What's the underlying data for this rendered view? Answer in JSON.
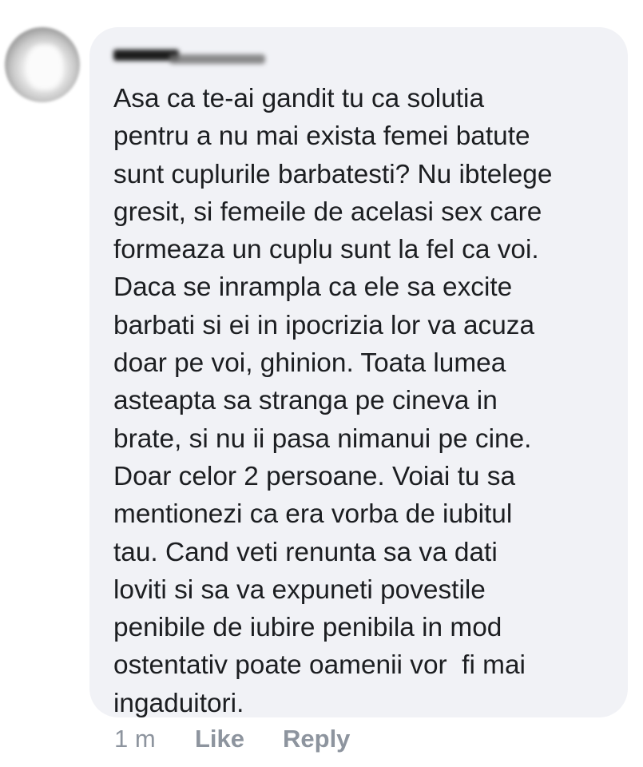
{
  "comment": {
    "author_redacted": true,
    "text_lines": [
      "Asa ca te-ai gandit tu ca solutia",
      "pentru a nu mai exista femei batute",
      "sunt cuplurile barbatesti? Nu ibtelege",
      "gresit, si femeile de acelasi sex care",
      "formeaza un cuplu sunt la fel ca voi.",
      "Daca se inrampla ca ele sa excite",
      "barbati si ei in ipocrizia lor va acuza",
      "doar pe voi, ghinion. Toata lumea",
      "asteapta sa stranga pe cineva in",
      "brate, si nu ii pasa nimanui pe cine.",
      "Doar celor 2 persoane. Voiai tu sa",
      "mentionezi ca era vorba de iubitul",
      "tau. Cand veti renunta sa va dati",
      "loviti si sa va expuneti povestile",
      "penibile de iubire penibila in mod",
      "ostentativ poate oamenii vor  fi mai",
      "ingaduitori."
    ],
    "timestamp": "1 m",
    "like_label": "Like",
    "reply_label": "Reply"
  },
  "colors": {
    "bubble_background": "#f1f2f6",
    "text": "#1c1e21",
    "action_text": "#8d949e"
  },
  "icons": {
    "avatar": "profile-picture-blurred"
  }
}
